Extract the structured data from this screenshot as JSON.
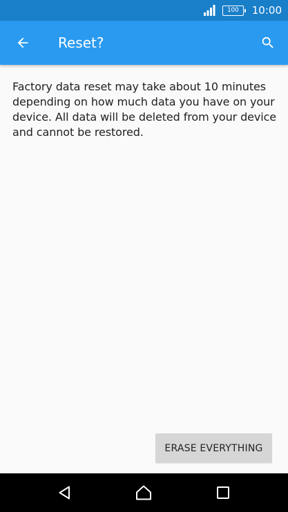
{
  "status_bar": {
    "battery_level": "100",
    "time": "10:00",
    "icons": [
      "signal-icon",
      "battery-icon"
    ]
  },
  "app_bar": {
    "title": "Reset?",
    "icons": [
      "arrow-left-icon",
      "search-icon"
    ]
  },
  "main": {
    "description": "Factory data reset may take about 10 minutes depending on how much data you have on your device. All data will be deleted from your device and cannot be restored.",
    "erase_label": "ERASE EVERYTHING"
  },
  "nav_bar": {
    "icons": [
      "nav-back-icon",
      "nav-home-icon",
      "nav-recents-icon"
    ]
  },
  "colors": {
    "status_bar": "#1a7fc9",
    "app_bar": "#2a9af0",
    "background": "#fafafa",
    "button": "#d6d6d6",
    "nav_bar": "#000000"
  }
}
